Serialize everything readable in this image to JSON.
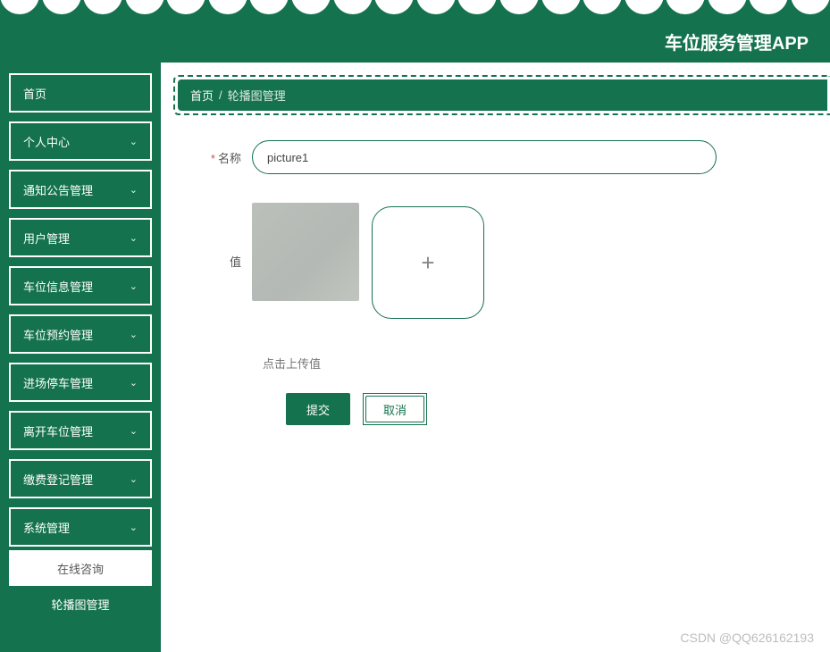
{
  "header": {
    "title": "车位服务管理APP"
  },
  "sidebar": {
    "items": [
      {
        "label": "首页",
        "expandable": false
      },
      {
        "label": "个人中心",
        "expandable": true
      },
      {
        "label": "通知公告管理",
        "expandable": true
      },
      {
        "label": "用户管理",
        "expandable": true
      },
      {
        "label": "车位信息管理",
        "expandable": true
      },
      {
        "label": "车位预约管理",
        "expandable": true
      },
      {
        "label": "进场停车管理",
        "expandable": true
      },
      {
        "label": "离开车位管理",
        "expandable": true
      },
      {
        "label": "缴费登记管理",
        "expandable": true
      },
      {
        "label": "系统管理",
        "expandable": true
      }
    ],
    "sub_items": [
      {
        "label": "在线咨询",
        "active": false
      },
      {
        "label": "轮播图管理",
        "active": true
      }
    ]
  },
  "breadcrumb": {
    "home": "首页",
    "separator": "/",
    "current": "轮播图管理"
  },
  "form": {
    "name_label": "名称",
    "name_value": "picture1",
    "value_label": "值",
    "upload_hint": "点击上传值",
    "submit_label": "提交",
    "cancel_label": "取消"
  },
  "watermark": "CSDN @QQ626162193",
  "icons": {
    "chevron_down": "⌄",
    "plus": "+"
  }
}
